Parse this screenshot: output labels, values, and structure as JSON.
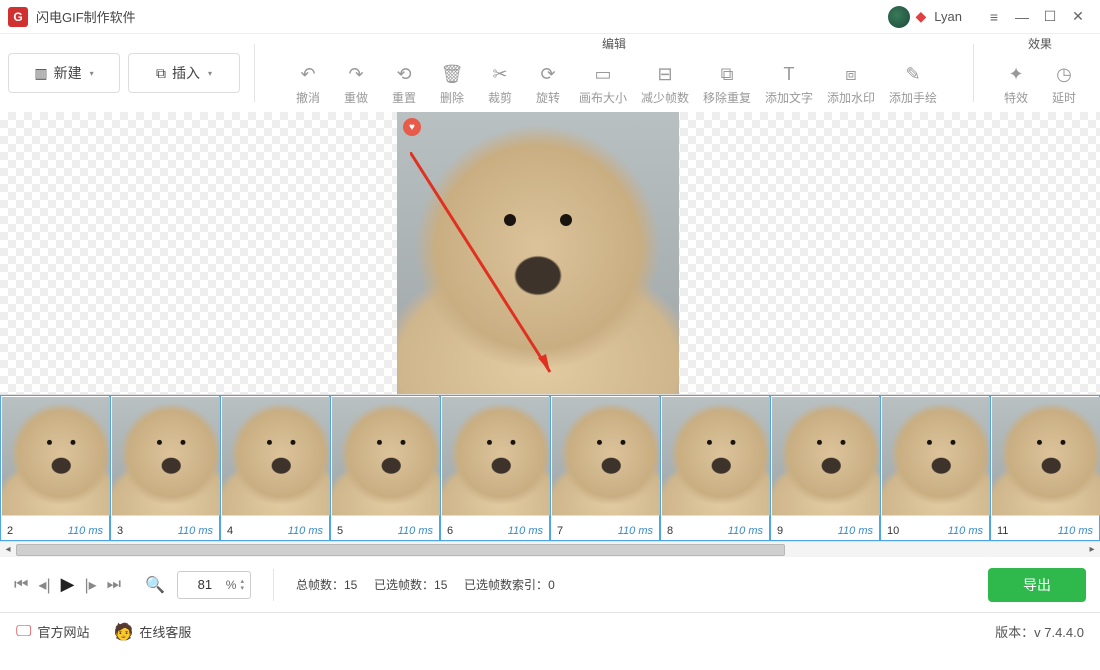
{
  "titlebar": {
    "app_title": "闪电GIF制作软件",
    "username": "Lyan"
  },
  "toolbar": {
    "new_label": "新建",
    "insert_label": "插入",
    "section_edit": "编辑",
    "section_effect": "效果",
    "tools_edit": [
      {
        "label": "撤消"
      },
      {
        "label": "重做"
      },
      {
        "label": "重置"
      },
      {
        "label": "删除"
      },
      {
        "label": "裁剪"
      },
      {
        "label": "旋转"
      },
      {
        "label": "画布大小"
      },
      {
        "label": "减少帧数"
      },
      {
        "label": "移除重复"
      },
      {
        "label": "添加文字"
      },
      {
        "label": "添加水印"
      },
      {
        "label": "添加手绘"
      }
    ],
    "tools_effect": [
      {
        "label": "特效"
      },
      {
        "label": "延时"
      }
    ]
  },
  "timeline": {
    "frames": [
      {
        "num": "2",
        "ms": "110 ms"
      },
      {
        "num": "3",
        "ms": "110 ms"
      },
      {
        "num": "4",
        "ms": "110 ms"
      },
      {
        "num": "5",
        "ms": "110 ms"
      },
      {
        "num": "6",
        "ms": "110 ms"
      },
      {
        "num": "7",
        "ms": "110 ms"
      },
      {
        "num": "8",
        "ms": "110 ms"
      },
      {
        "num": "9",
        "ms": "110 ms"
      },
      {
        "num": "10",
        "ms": "110 ms"
      },
      {
        "num": "11",
        "ms": "110 ms"
      }
    ]
  },
  "controls": {
    "zoom_value": "81",
    "zoom_pct": "%",
    "total_frames_label": "总帧数：",
    "total_frames_value": "15",
    "selected_frames_label": "已选帧数：",
    "selected_frames_value": "15",
    "selected_index_label": "已选帧数索引：",
    "selected_index_value": "0",
    "export_label": "导出"
  },
  "footer": {
    "official_site": "官方网站",
    "online_service": "在线客服",
    "version_label": "版本：",
    "version_value": "v 7.4.4.0"
  }
}
